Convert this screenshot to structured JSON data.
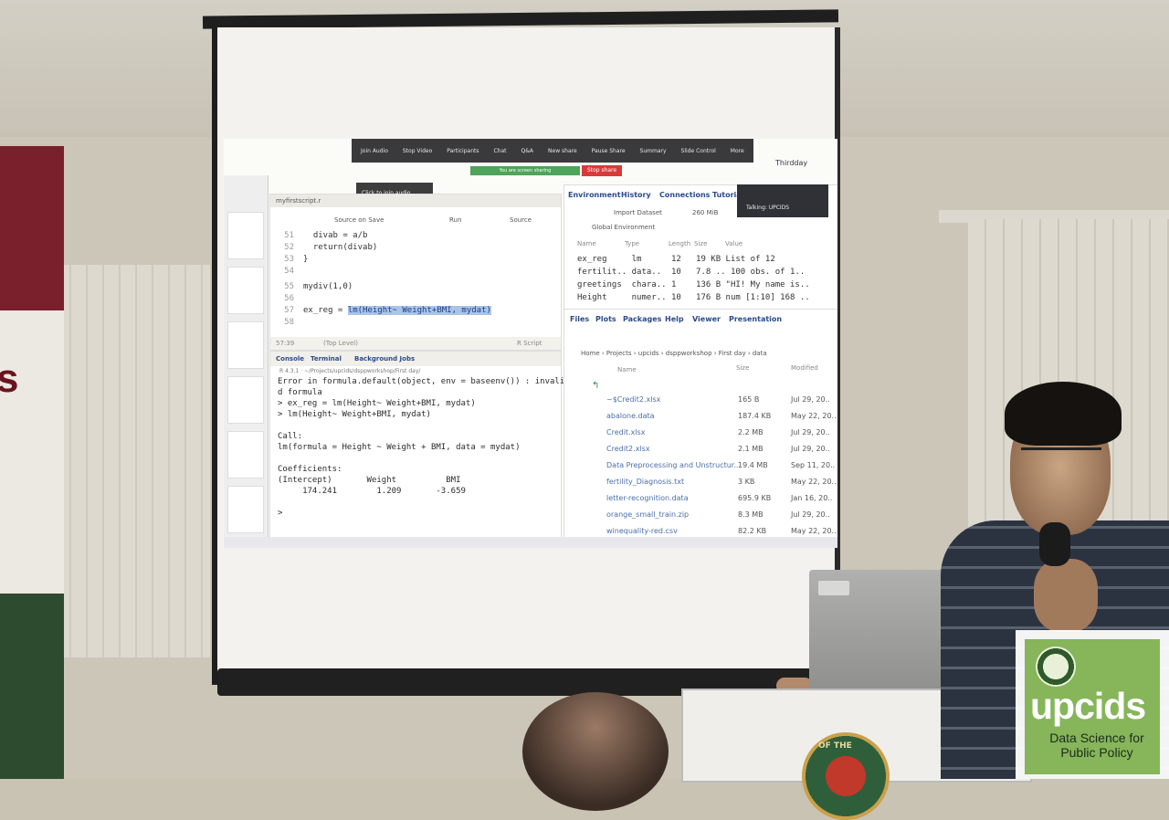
{
  "zoom_bar": {
    "items": [
      "Join Audio",
      "Stop Video",
      "Participants",
      "Chat",
      "Q&A",
      "New share",
      "Pause Share",
      "Summary",
      "Slide Control",
      "More"
    ],
    "sharing": "You are screen sharing",
    "stop_share": "Stop share",
    "tooltip": "Click to join audio",
    "talking": "Talking: UPCIDS",
    "host": "Thirdday"
  },
  "editor": {
    "tab": "myfirstscript.r",
    "toolbar": [
      "Source on Save",
      "Run",
      "Source"
    ],
    "lines": [
      {
        "n": "51",
        "code": "  divab = a/b"
      },
      {
        "n": "52",
        "code": "  return(divab)"
      },
      {
        "n": "53",
        "code": "}"
      },
      {
        "n": "54",
        "code": ""
      },
      {
        "n": "55",
        "code": "mydiv(1,0)"
      },
      {
        "n": "56",
        "code": ""
      },
      {
        "n": "57",
        "code": "ex_reg = ",
        "highlight": "lm(Height~ Weight+BMI, mydat)"
      },
      {
        "n": "58",
        "code": ""
      }
    ],
    "status_left": "57:39",
    "status_mid": "(Top Level)",
    "status_right": "R Script"
  },
  "console": {
    "tabs": [
      "Console",
      "Terminal",
      "Background Jobs"
    ],
    "path": "R 4.3.1 · ~/Projects/upcids/dsppworkshop/First day/",
    "lines": [
      "Error in formula.default(object, env = baseenv()) : invali",
      "d formula",
      "> ex_reg = lm(Height~ Weight+BMI, mydat)",
      "> lm(Height~ Weight+BMI, mydat)",
      "",
      "Call:",
      "lm(formula = Height ~ Weight + BMI, data = mydat)",
      "",
      "Coefficients:",
      "(Intercept)       Weight          BMI",
      "     174.241        1.209       -3.659",
      "",
      ">"
    ]
  },
  "environment": {
    "tabs": [
      "Environment",
      "History",
      "Connections",
      "Tutorial"
    ],
    "import": "Import Dataset",
    "memory": "260 MiB",
    "scope": "Global Environment",
    "columns": [
      "Name",
      "Type",
      "Length",
      "Size",
      "Value"
    ],
    "rows": [
      "ex_reg     lm      12   19 KB List of 12",
      "fertilit.. data..  10   7.8 .. 100 obs. of 1..",
      "greetings  chara.. 1    136 B \"HI! My name is..",
      "Height     numer.. 10   176 B num [1:10] 168 .."
    ]
  },
  "files": {
    "tabs": [
      "Files",
      "Plots",
      "Packages",
      "Help",
      "Viewer",
      "Presentation"
    ],
    "breadcrumb": "Home › Projects › upcids › dsppworkshop › First day › data",
    "columns": [
      "Name",
      "Size",
      "Modified"
    ],
    "rows": [
      {
        "name": "~$Credit2.xlsx",
        "size": "165 B",
        "modified": "Jul 29, 20.."
      },
      {
        "name": "abalone.data",
        "size": "187.4 KB",
        "modified": "May 22, 20.."
      },
      {
        "name": "Credit.xlsx",
        "size": "2.2 MB",
        "modified": "Jul 29, 20.."
      },
      {
        "name": "Credit2.xlsx",
        "size": "2.1 MB",
        "modified": "Jul 29, 20.."
      },
      {
        "name": "Data Preprocessing and Unstructur...",
        "size": "19.4 MB",
        "modified": "Sep 11, 20.."
      },
      {
        "name": "fertility_Diagnosis.txt",
        "size": "3 KB",
        "modified": "May 22, 20.."
      },
      {
        "name": "letter-recognition.data",
        "size": "695.9 KB",
        "modified": "Jan 16, 20.."
      },
      {
        "name": "orange_small_train.zip",
        "size": "8.3 MB",
        "modified": "Jul 29, 20.."
      },
      {
        "name": "winequality-red.csv",
        "size": "82.2 KB",
        "modified": "May 22, 20.."
      }
    ]
  },
  "logo": {
    "name": "upcids",
    "tagline": "Data Science for Public Policy"
  },
  "podium_seal_text": "OF THE"
}
